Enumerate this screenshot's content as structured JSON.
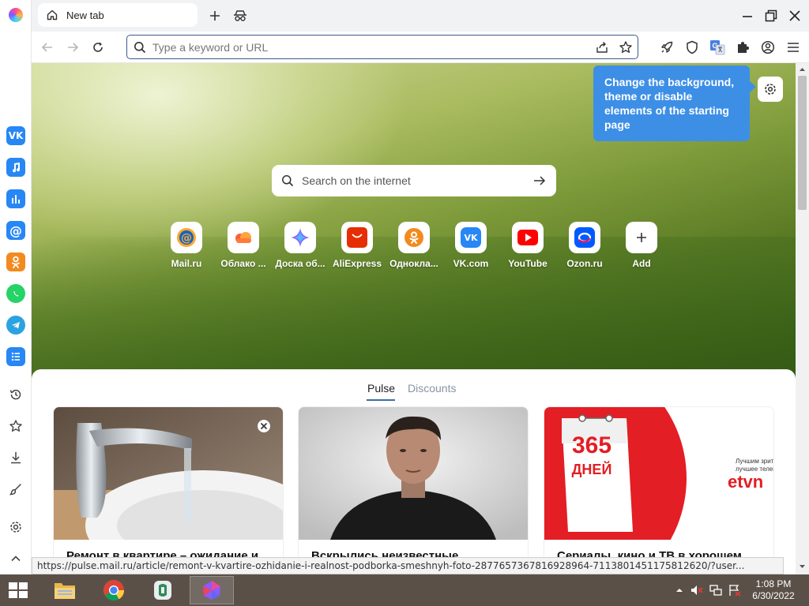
{
  "tabs": [
    {
      "label": "New tab"
    }
  ],
  "address_bar": {
    "placeholder": "Type a keyword or URL"
  },
  "tooltip": {
    "text": "Change the background, theme or disable elements of the starting page"
  },
  "search": {
    "placeholder": "Search on the internet"
  },
  "shortcuts": [
    {
      "label": "Mail.ru"
    },
    {
      "label": "Облако ..."
    },
    {
      "label": "Доска об..."
    },
    {
      "label": "AliExpress"
    },
    {
      "label": "Однокла..."
    },
    {
      "label": "VK.com"
    },
    {
      "label": "YouTube"
    },
    {
      "label": "Ozon.ru"
    },
    {
      "label": "Add"
    }
  ],
  "feed": {
    "tabs": [
      "Pulse",
      "Discounts"
    ],
    "active_tab": "Pulse",
    "cards": [
      {
        "title": "Ремонт в квартире – ожидание и"
      },
      {
        "title": "Вскрылись неизвестные"
      },
      {
        "title": "Сериалы, кино и ТВ в хорошем",
        "promo_number": "365",
        "promo_word": "ДНЕЙ",
        "promo_tagline_1": "Лучшим зрит",
        "promo_tagline_2": "лучшее телев",
        "promo_brand": "etvn"
      }
    ]
  },
  "status_url": "https://pulse.mail.ru/article/remont-v-kvartire-ozhidanie-i-realnost-podborka-smeshnyh-foto-2877657367816928964-7113801451175812620/?user...",
  "taskbar": {
    "time": "1:08 PM",
    "date": "6/30/2022"
  },
  "colors": {
    "accent": "#3d8fe6",
    "vk": "#2787f5",
    "ok": "#f28a1e",
    "whatsapp": "#25d366",
    "telegram": "#2aa3e0",
    "taskbar": "#5b5048"
  }
}
